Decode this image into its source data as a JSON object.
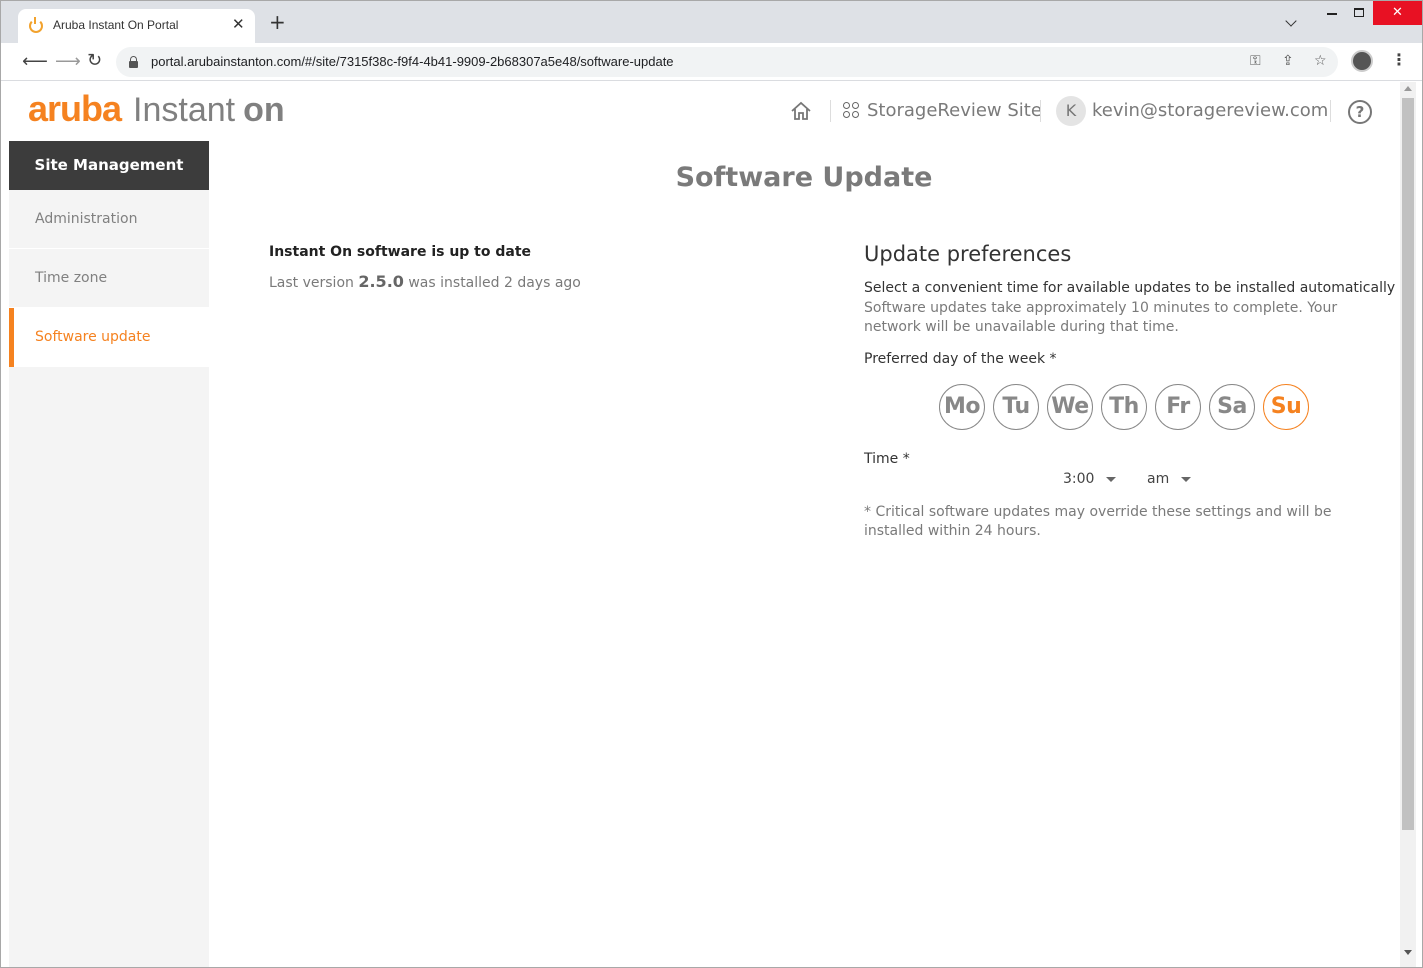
{
  "browser": {
    "tab_title": "Aruba Instant On Portal",
    "tab_close": "✕",
    "new_tab": "+",
    "url": "portal.arubainstanton.com/#/site/7315f38c-f9f4-4b41-9909-2b68307a5e48/software-update",
    "window_close": "✕"
  },
  "header": {
    "logo_aruba": "aruba",
    "logo_instant": "Instant",
    "logo_on": "on",
    "site_name": "StorageReview Site",
    "avatar_initial": "K",
    "user_email": "kevin@storagereview.com",
    "help": "?"
  },
  "sidebar": {
    "title": "Site Management",
    "items": [
      {
        "label": "Administration",
        "active": false
      },
      {
        "label": "Time zone",
        "active": false
      },
      {
        "label": "Software update",
        "active": true
      }
    ]
  },
  "main": {
    "title": "Software Update",
    "status_title": "Instant On software is up to date",
    "status_prefix": "Last version",
    "version": "2.5.0",
    "status_suffix": "was installed 2 days ago"
  },
  "preferences": {
    "title": "Update preferences",
    "subtitle": "Select a convenient time for available updates to be installed automatically",
    "description": "Software updates take approximately 10 minutes to complete. Your network will be unavailable during that time.",
    "day_label": "Preferred day of the week *",
    "days": [
      "Mo",
      "Tu",
      "We",
      "Th",
      "Fr",
      "Sa",
      "Su"
    ],
    "selected_day": "Su",
    "time_label": "Time *",
    "time_value": "3:00",
    "ampm_value": "am",
    "note": "* Critical software updates may override these settings and will be installed within 24 hours."
  },
  "colors": {
    "accent": "#f58220",
    "sidebar_header": "#3c3c3c"
  }
}
